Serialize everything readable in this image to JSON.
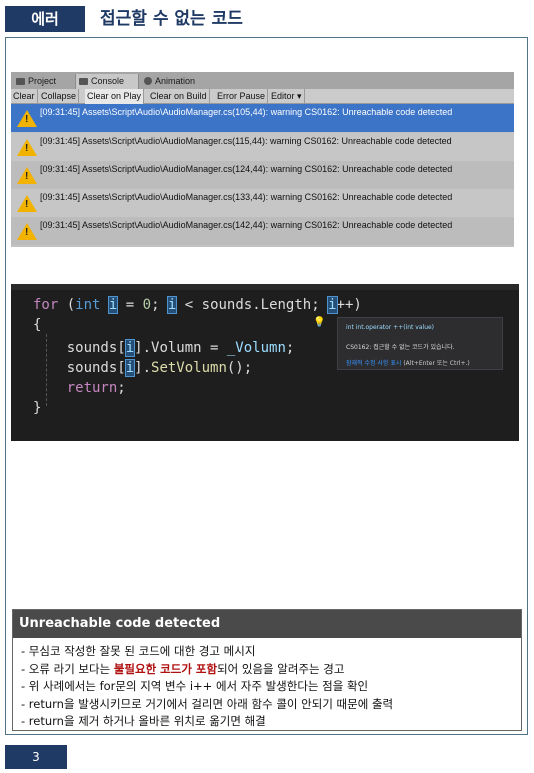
{
  "header": {
    "tag": "에러",
    "title": "접근할 수 없는 코드"
  },
  "unity": {
    "tabs": [
      "Project",
      "Console",
      "Animation"
    ],
    "toolbar": [
      "Clear",
      "Collapse",
      "Clear on Play",
      "Clear on Build",
      "Error Pause",
      "Editor ▾"
    ],
    "logs": [
      "[09:31:45] Assets\\Script\\Audio\\AudioManager.cs(105,44): warning CS0162: Unreachable code detected",
      "[09:31:45] Assets\\Script\\Audio\\AudioManager.cs(115,44): warning CS0162: Unreachable code detected",
      "[09:31:45] Assets\\Script\\Audio\\AudioManager.cs(124,44): warning CS0162: Unreachable code detected",
      "[09:31:45] Assets\\Script\\Audio\\AudioManager.cs(133,44): warning CS0162: Unreachable code detected",
      "[09:31:45] Assets\\Script\\Audio\\AudioManager.cs(142,44): warning CS0162: Unreachable code detected"
    ]
  },
  "code": {
    "popup_line1": "int int.operator ++(int value)",
    "popup_line2": "CS0162: 접근할 수 없는 코드가 있습니다.",
    "popup_line3": "잠재적 수정 사항 표시",
    "popup_line3_hint": "(Alt+Enter 또는 Ctrl+.)"
  },
  "box": {
    "heading": "Unreachable code detected",
    "items": [
      "- 무심코 작성한 잘못 된 코드에 대한 경고 메시지",
      "- 위 사례에서는 for문의 지역 변수 i++ 에서 자주 발생한다는 점을 확인",
      "- return을 발생시키므로 거기에서 걸리면 아래 함수 콜이 안되기 때문에 출력",
      "- return을 제거 하거나 올바른 위치로 옮기면 해결"
    ],
    "item2_pre": "- 오류 라기 보다는 ",
    "item2_em": "불필요한 코드가 포함",
    "item2_post": "되어 있음을 알려주는 경고"
  },
  "page_number": "3"
}
